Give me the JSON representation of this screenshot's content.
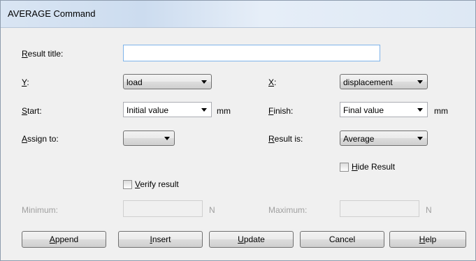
{
  "window": {
    "title": "AVERAGE Command"
  },
  "form": {
    "result_title": {
      "label_key": "R",
      "label_rest": "esult title:",
      "value": ""
    },
    "y": {
      "label_key": "Y",
      "label_rest": ":",
      "value": "load"
    },
    "x": {
      "label_key": "X",
      "label_rest": ":",
      "value": "displacement"
    },
    "start": {
      "label_key": "S",
      "label_rest": "tart:",
      "value": "Initial value",
      "unit": "mm"
    },
    "finish": {
      "label_key": "F",
      "label_rest": "inish:",
      "value": "Final value",
      "unit": "mm"
    },
    "assign_to": {
      "label_key": "A",
      "label_rest": "ssign to:",
      "value": ""
    },
    "result_is": {
      "label_key": "R",
      "label_rest": "esult is:",
      "value": "Average"
    },
    "hide_result": {
      "label_key": "H",
      "label_rest": "ide Result",
      "checked": false
    },
    "verify_result": {
      "label_key": "V",
      "label_rest": "erify result",
      "checked": false
    },
    "minimum": {
      "label": "Minimum:",
      "value": "",
      "unit": "N"
    },
    "maximum": {
      "label": "Maximum:",
      "value": "",
      "unit": "N"
    }
  },
  "buttons": {
    "append": {
      "key": "A",
      "rest": "ppend"
    },
    "insert": {
      "key": "I",
      "rest": "nsert"
    },
    "update": {
      "key": "U",
      "rest": "pdate"
    },
    "cancel": {
      "label": "Cancel"
    },
    "help": {
      "key": "H",
      "rest": "elp"
    }
  }
}
